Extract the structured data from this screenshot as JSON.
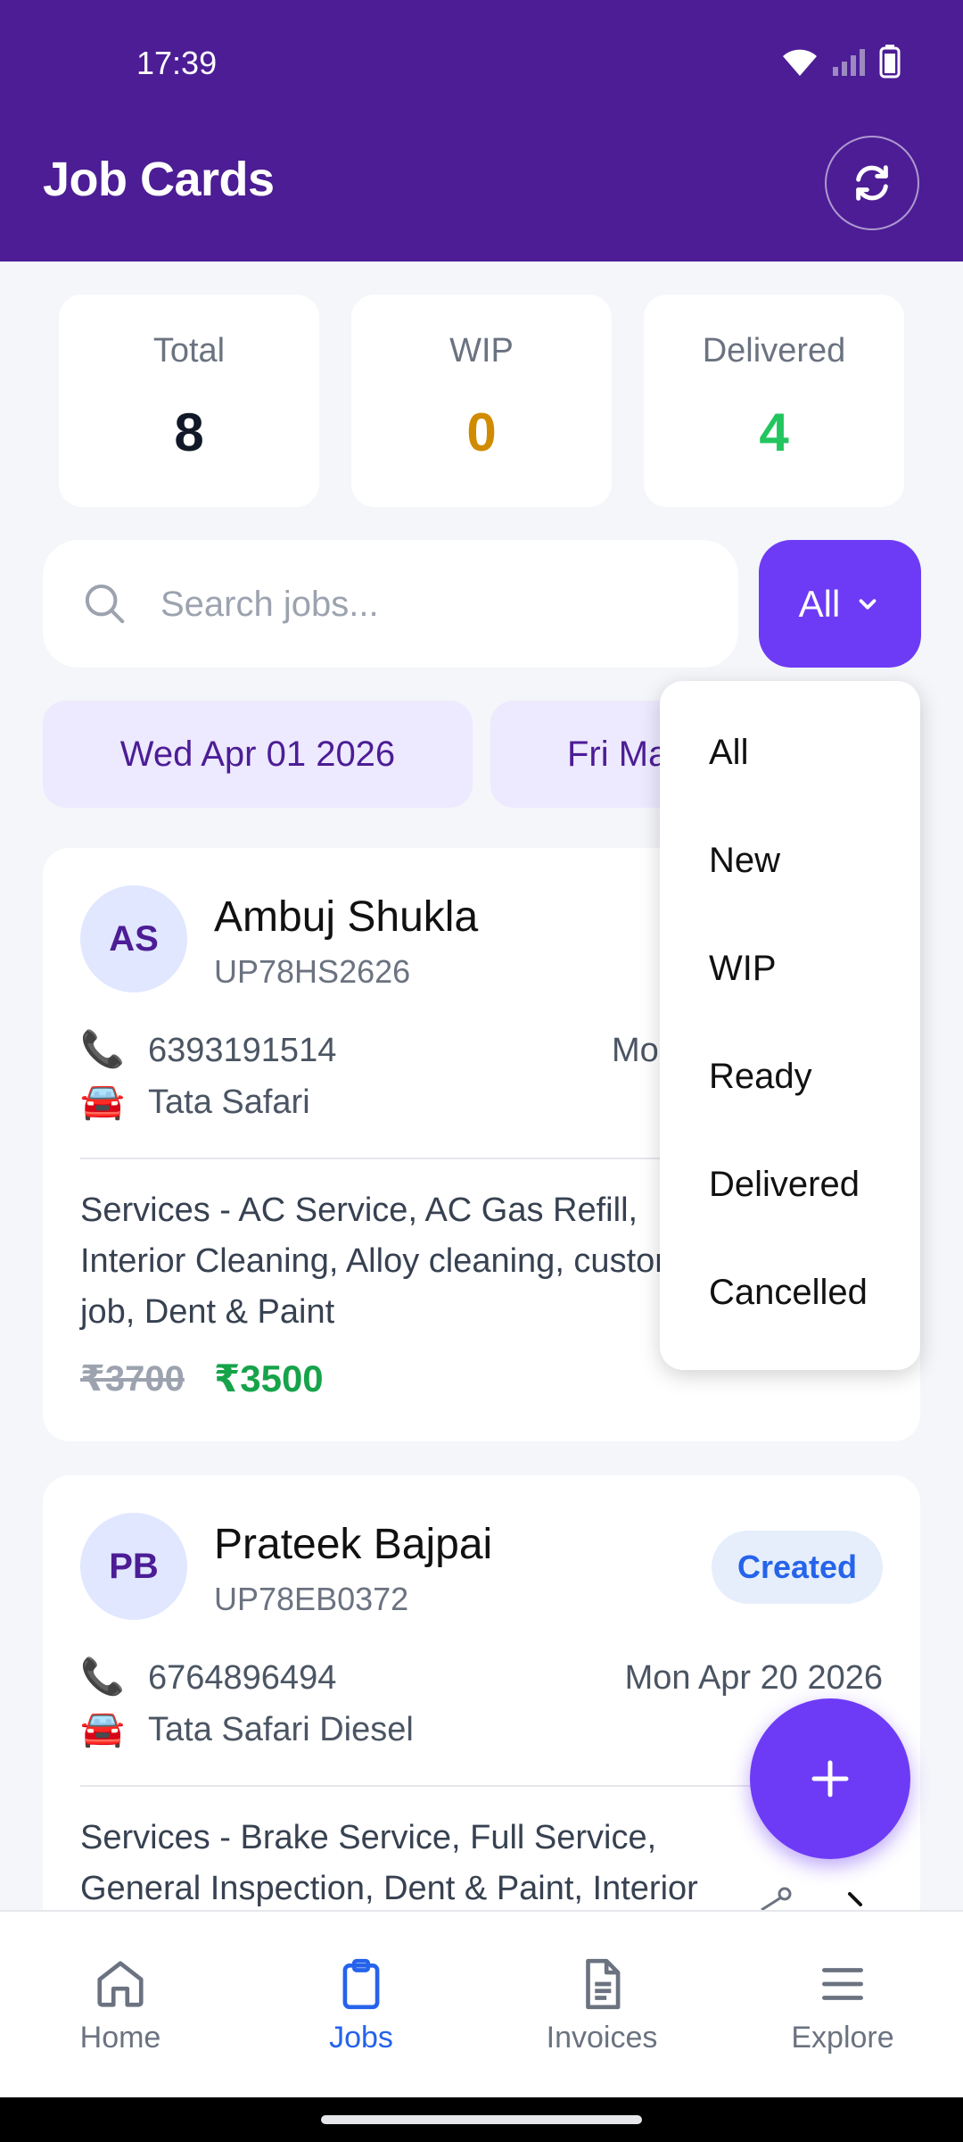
{
  "status_bar": {
    "time": "17:39"
  },
  "header": {
    "title": "Job Cards"
  },
  "stats": {
    "total": {
      "label": "Total",
      "value": "8",
      "color": "#111827"
    },
    "wip": {
      "label": "WIP",
      "value": "0",
      "color": "#d18b00"
    },
    "delivered": {
      "label": "Delivered",
      "value": "4",
      "color": "#22c55e"
    }
  },
  "search": {
    "placeholder": "Search jobs...",
    "value": ""
  },
  "filter": {
    "selected": "All"
  },
  "date_chips": [
    "Wed Apr 01 2026",
    "Fri Ma"
  ],
  "dropdown": {
    "options": [
      "All",
      "New",
      "WIP",
      "Ready",
      "Delivered",
      "Cancelled"
    ]
  },
  "jobs": [
    {
      "initials": "AS",
      "name": "Ambuj Shukla",
      "plate": "UP78HS2626",
      "phone": "6393191514",
      "date": "Mo",
      "vehicle": "Tata Safari",
      "services_lines": [
        "Services - AC Service, AC Gas Refill,",
        "Interior Cleaning, Alloy cleaning, custor",
        "job, Dent & Paint"
      ],
      "price_original": "₹3700",
      "price_final": "₹3500"
    },
    {
      "initials": "PB",
      "name": "Prateek Bajpai",
      "plate": "UP78EB0372",
      "status": "Created",
      "phone": "6764896494",
      "date": "Mon Apr 20 2026",
      "vehicle": "Tata Safari Diesel",
      "services_lines": [
        "Services - Brake Service, Full Service,",
        "General Inspection, Dent & Paint, Interior"
      ]
    }
  ],
  "fab": {
    "icon": "plus-icon"
  },
  "bottom_nav": [
    {
      "label": "Home",
      "icon": "home-icon",
      "active": false
    },
    {
      "label": "Jobs",
      "icon": "clipboard-icon",
      "active": true
    },
    {
      "label": "Invoices",
      "icon": "document-icon",
      "active": false
    },
    {
      "label": "Explore",
      "icon": "menu-icon",
      "active": false
    }
  ],
  "colors": {
    "primary": "#4c1d95",
    "accent": "#6d3bf5",
    "active_nav": "#2563eb",
    "success": "#16a34a"
  }
}
